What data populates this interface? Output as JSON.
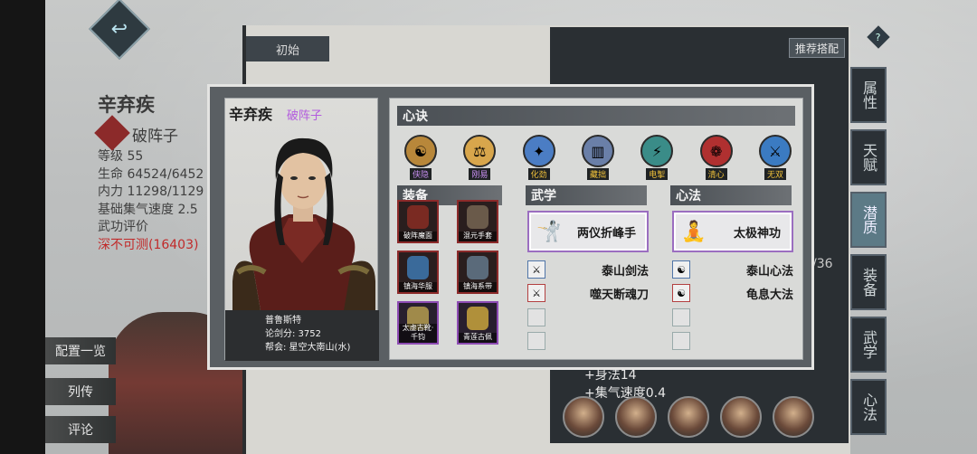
{
  "background": {
    "char_name": "辛弃疾",
    "char_title": "破阵子",
    "stats": [
      "等级 55",
      "生命 64524/6452",
      "内力 11298/1129",
      "基础集气速度 2.5",
      "武功评价"
    ],
    "rating": "深不可测(16403)",
    "side_buttons": [
      "配置一览",
      "列传",
      "评论"
    ],
    "tab_init": "初始",
    "recommend": "推荐搭配",
    "help": "?",
    "right_tabs": [
      "属性",
      "天赋",
      "潜质",
      "装备",
      "武学",
      "心法"
    ],
    "stat_lines": [
      "+身法14",
      "+集气速度0.4"
    ],
    "page_fraction": "/36"
  },
  "modal": {
    "name": "辛弃疾",
    "subtitle": "破阵子",
    "owner_name": "普鲁斯特",
    "score_label": "论剑分: 3752",
    "guild_label": "帮会: 星空大南山(水)",
    "mantra_header": "心诀",
    "mantras": [
      {
        "label": "侠隐",
        "color": "#b8873a",
        "label_color": "#c78ff0"
      },
      {
        "label": "刚易",
        "color": "#d8a64c",
        "label_color": "#c78ff0"
      },
      {
        "label": "化劲",
        "color": "#4b7dc4",
        "label_color": "#f2c23a"
      },
      {
        "label": "藏拙",
        "color": "#6a7fa8",
        "label_color": "#f2c23a"
      },
      {
        "label": "电掣",
        "color": "#3a8c88",
        "label_color": "#f2c23a"
      },
      {
        "label": "清心",
        "color": "#b03030",
        "label_color": "#f2c23a"
      },
      {
        "label": "无双",
        "color": "#3b7bc2",
        "label_color": "#f2c23a"
      }
    ],
    "equip_header": "装备",
    "equipment": [
      "破阵魔面",
      "混元手套",
      "镇海华服",
      "镇海系带",
      "太虚古靴·千钧",
      "青莲古佩"
    ],
    "martial_header": "武学",
    "martial_main": "两仪折峰手",
    "martial_list": [
      "泰山剑法",
      "噬天断魂刀"
    ],
    "heart_header": "心法",
    "heart_main": "太极神功",
    "heart_list": [
      "泰山心法",
      "龟息大法"
    ]
  }
}
